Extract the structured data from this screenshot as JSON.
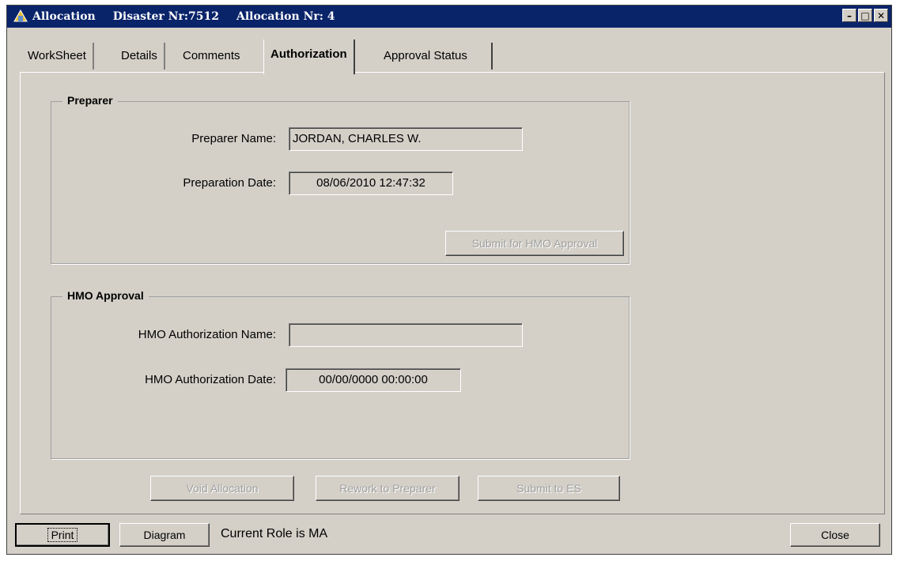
{
  "titlebar": {
    "app_title": "Allocation",
    "disaster": "Disaster Nr:7512",
    "allocation": "Allocation Nr: 4"
  },
  "window_controls": {
    "minimize": "–",
    "maximize": "□",
    "close": "✕"
  },
  "tabs": [
    {
      "label": "WorkSheet",
      "active": false
    },
    {
      "label": "Details",
      "active": false
    },
    {
      "label": "Comments",
      "active": false
    },
    {
      "label": "Authorization",
      "active": true
    },
    {
      "label": "Approval Status",
      "active": false
    }
  ],
  "preparer": {
    "group_title": "Preparer",
    "name_label": "Preparer Name:",
    "name_value": "JORDAN, CHARLES W.",
    "date_label": "Preparation Date:",
    "date_value": "08/06/2010  12:47:32",
    "submit_button": "Submit for HMO Approval"
  },
  "hmo": {
    "group_title": "HMO Approval",
    "name_label": "HMO Authorization Name:",
    "name_value": "",
    "date_label": "HMO Authorization Date:",
    "date_value": "00/00/0000 00:00:00"
  },
  "actions": {
    "void": "Void Allocation",
    "rework": "Rework to Preparer",
    "submit_es": "Submit to ES"
  },
  "footer": {
    "print": "Print",
    "diagram": "Diagram",
    "role_text": "Current Role is MA",
    "close": "Close"
  },
  "colors": {
    "titlebar": "#0a246a",
    "face": "#d4d0c8",
    "disabled_text": "#a0a0a0"
  }
}
